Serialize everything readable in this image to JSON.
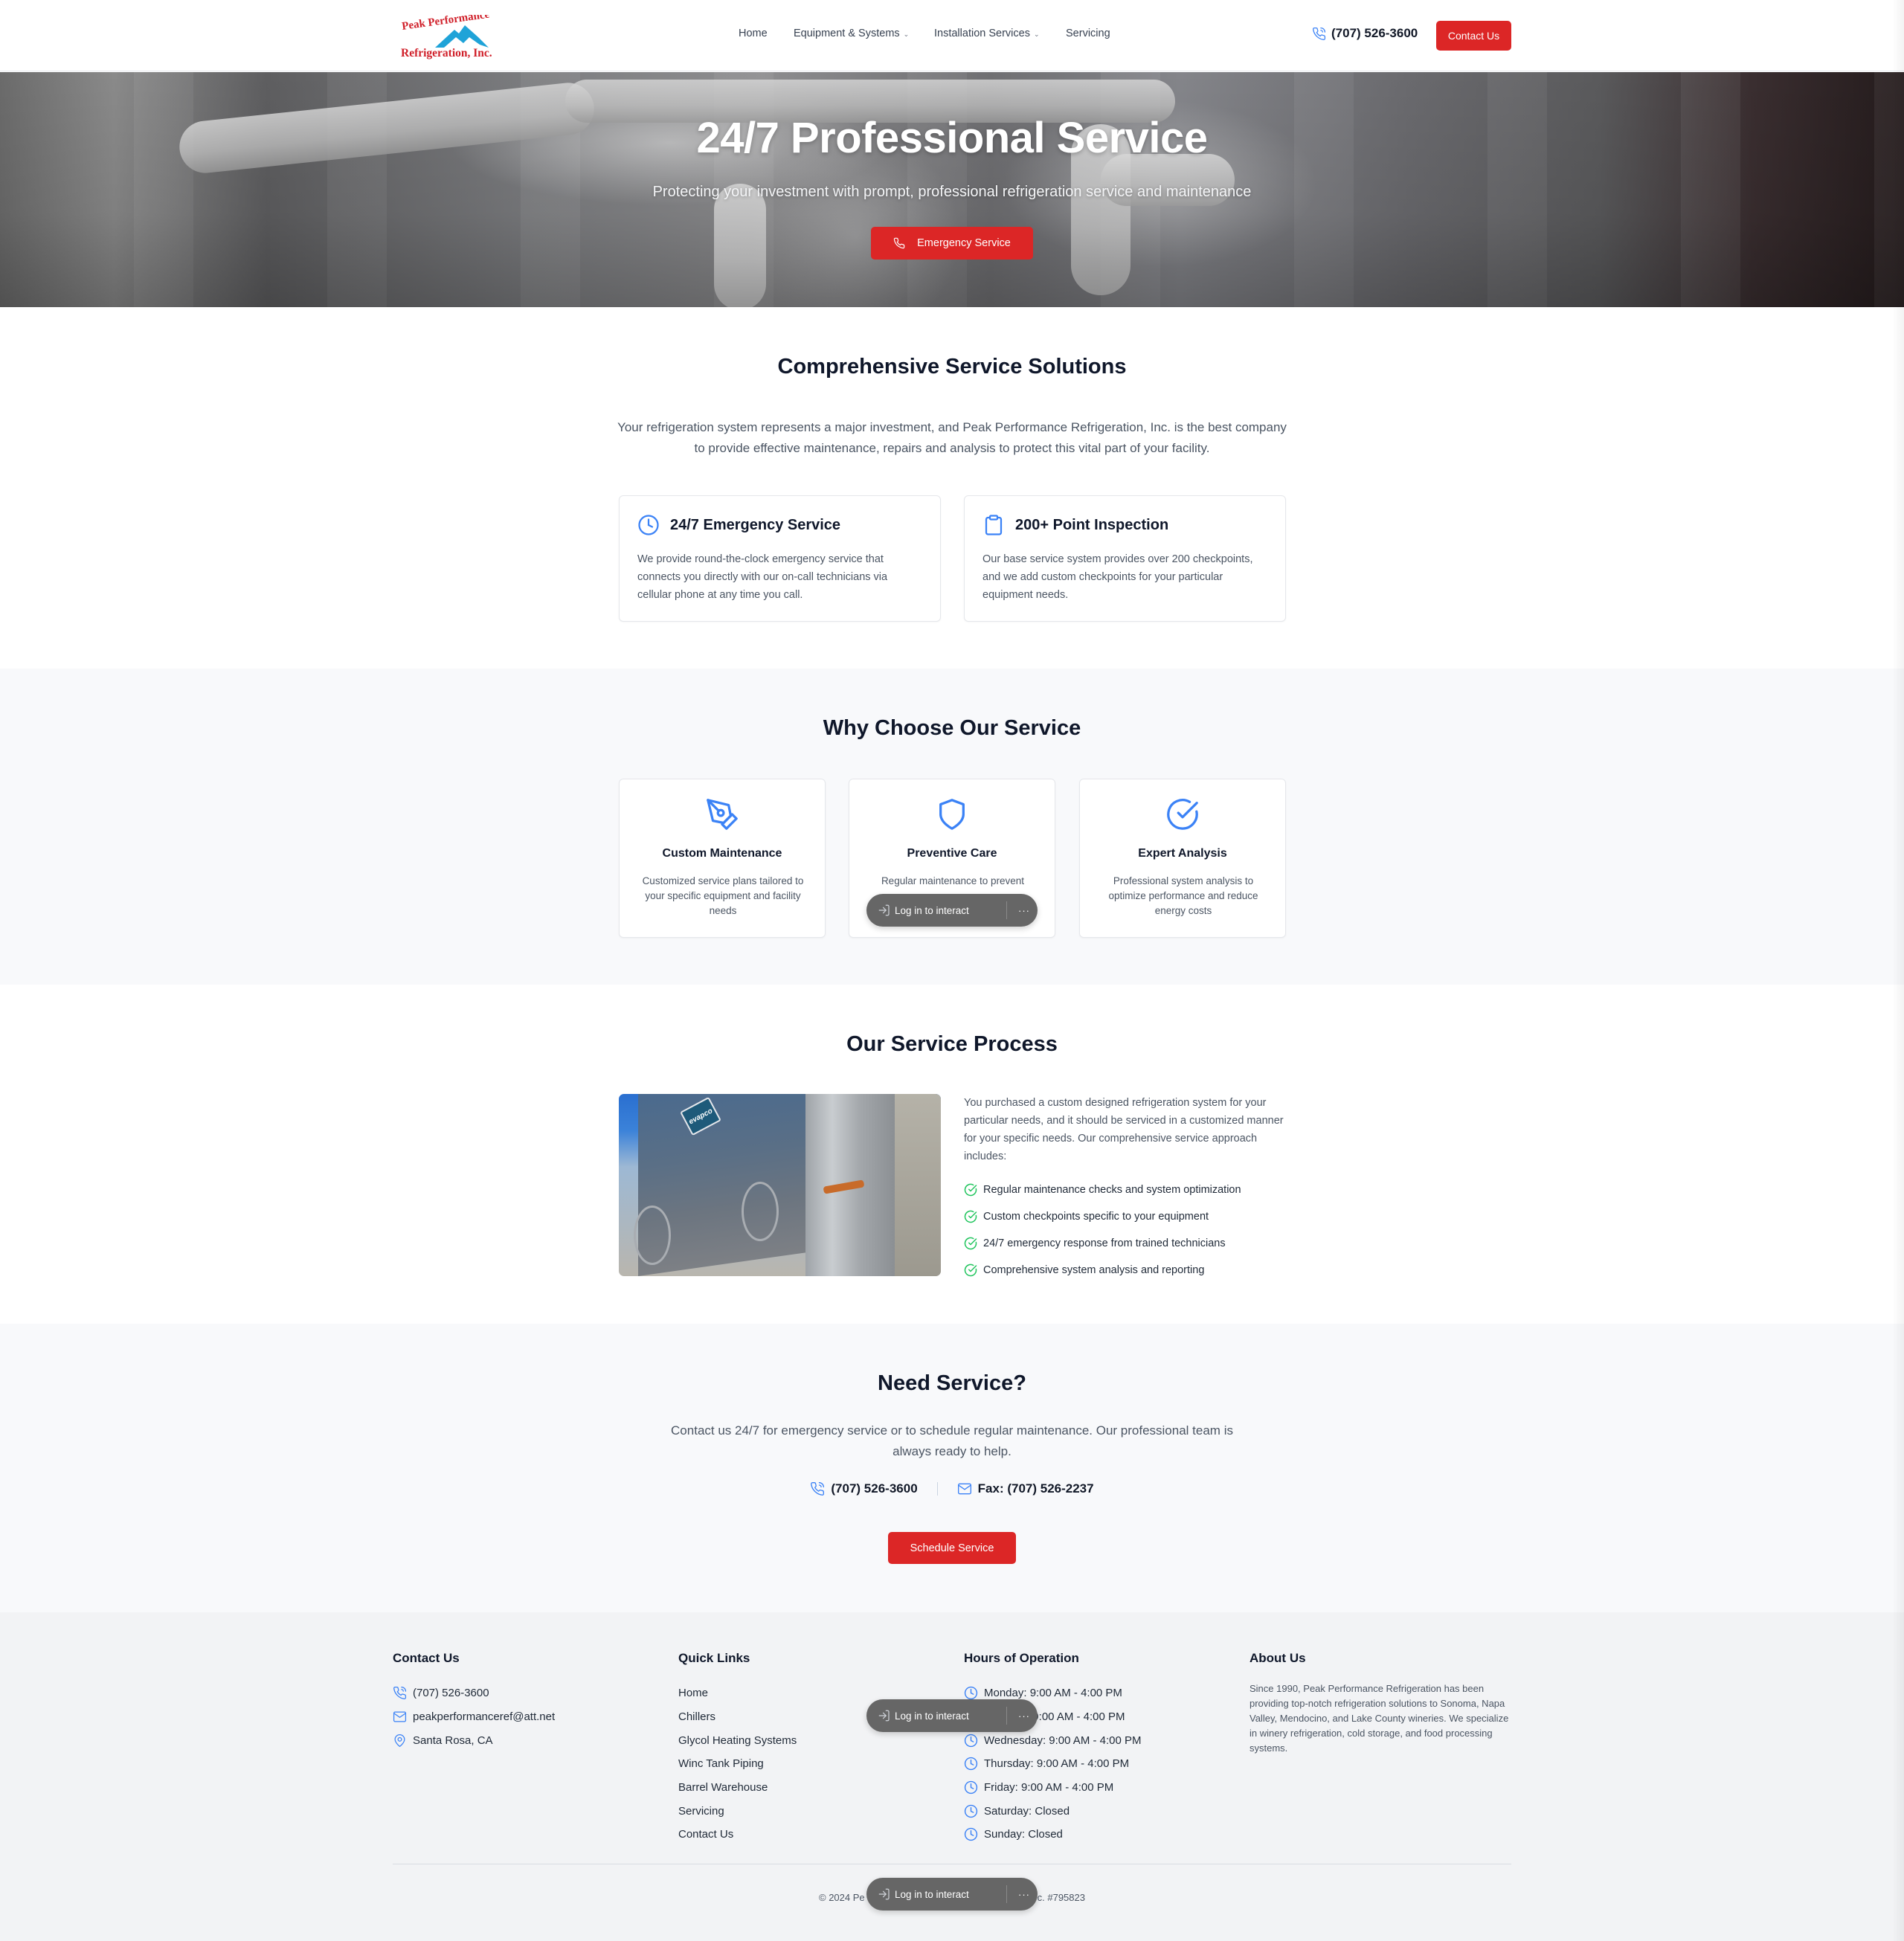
{
  "brand": {
    "name_line1": "Peak Performance",
    "name_line2": "Refrigeration, Inc.",
    "colors": {
      "primary_red": "#dc2626",
      "icon_blue": "#3b82f6",
      "check_green": "#22c55e",
      "logo_red": "#d0202a",
      "logo_blue": "#1fa3d8"
    }
  },
  "nav": {
    "links": [
      {
        "label": "Home",
        "has_dropdown": false
      },
      {
        "label": "Equipment & Systems",
        "has_dropdown": true
      },
      {
        "label": "Installation Services",
        "has_dropdown": true
      },
      {
        "label": "Servicing",
        "has_dropdown": false
      }
    ],
    "phone": "(707) 526-3600",
    "contact_button": "Contact Us",
    "icons": {
      "phone": "phone-icon",
      "dropdown": "chevron-down-icon"
    }
  },
  "hero": {
    "title": "24/7 Professional Service",
    "subtitle": "Protecting your investment with prompt, professional refrigeration service and maintenance",
    "button": "Emergency Service",
    "button_icon": "phone-icon"
  },
  "solutions": {
    "title": "Comprehensive Service Solutions",
    "lead": "Your refrigeration system represents a major investment, and Peak Performance Refrigeration, Inc. is the best company to provide effective maintenance, repairs and analysis to protect this vital part of your facility.",
    "cards": [
      {
        "icon": "clock-icon",
        "title": "24/7 Emergency Service",
        "text": "We provide round-the-clock emergency service that connects you directly with our on-call technicians via cellular phone at any time you call."
      },
      {
        "icon": "clipboard-icon",
        "title": "200+ Point Inspection",
        "text": "Our base service system provides over 200 checkpoints, and we add custom checkpoints for your particular equipment needs."
      }
    ]
  },
  "why": {
    "title": "Why Choose Our Service",
    "cards": [
      {
        "icon": "pen-tool-icon",
        "title": "Custom Maintenance",
        "text": "Customized service plans tailored to your specific equipment and facility needs"
      },
      {
        "icon": "shield-icon",
        "title": "Preventive Care",
        "text": "Regular maintenance to prevent"
      },
      {
        "icon": "check-circle-icon",
        "title": "Expert Analysis",
        "text": "Professional system analysis to optimize performance and reduce energy costs"
      }
    ]
  },
  "process": {
    "title": "Our Service Process",
    "image_badge": "evapco",
    "intro": "You purchased a custom designed refrigeration system for your particular needs, and it should be serviced in a customized manner for your specific needs. Our comprehensive service approach includes:",
    "items": [
      "Regular maintenance checks and system optimization",
      "Custom checkpoints specific to your equipment",
      "24/7 emergency response from trained technicians",
      "Comprehensive system analysis and reporting"
    ]
  },
  "cta": {
    "title": "Need Service?",
    "lead": "Contact us 24/7 for emergency service or to schedule regular maintenance. Our professional team is always ready to help.",
    "phone": "(707) 526-3600",
    "fax": "Fax: (707) 526-2237",
    "button": "Schedule Service"
  },
  "footer": {
    "contact": {
      "title": "Contact Us",
      "phone": "(707) 526-3600",
      "email": "peakperformanceref@att.net",
      "location": "Santa Rosa, CA"
    },
    "quick_links": {
      "title": "Quick Links",
      "links": [
        "Home",
        "Chillers",
        "Glycol Heating Systems",
        "Winc Tank Piping",
        "Barrel Warehouse",
        "Servicing",
        "Contact Us"
      ]
    },
    "hours": {
      "title": "Hours of Operation",
      "items": [
        "Monday: 9:00 AM - 4:00 PM",
        "Tuesday: 9:00 AM - 4:00 PM",
        "Wednesday: 9:00 AM - 4:00 PM",
        "Thursday: 9:00 AM - 4:00 PM",
        "Friday: 9:00 AM - 4:00 PM",
        "Saturday: Closed",
        "Sunday: Closed"
      ]
    },
    "about": {
      "title": "About Us",
      "text": "Since 1990, Peak Performance Refrigeration has been providing top-notch refrigeration solutions to Sonoma, Napa Valley, Mendocino, and Lake County wineries. We specialize in winery refrigeration, cold storage, and food processing systems."
    },
    "copyright_left": "© 2024 Pe",
    "copyright_right": "c. #795823"
  },
  "overlay": {
    "label": "Log in to interact",
    "more": "···",
    "icon": "login-icon"
  }
}
